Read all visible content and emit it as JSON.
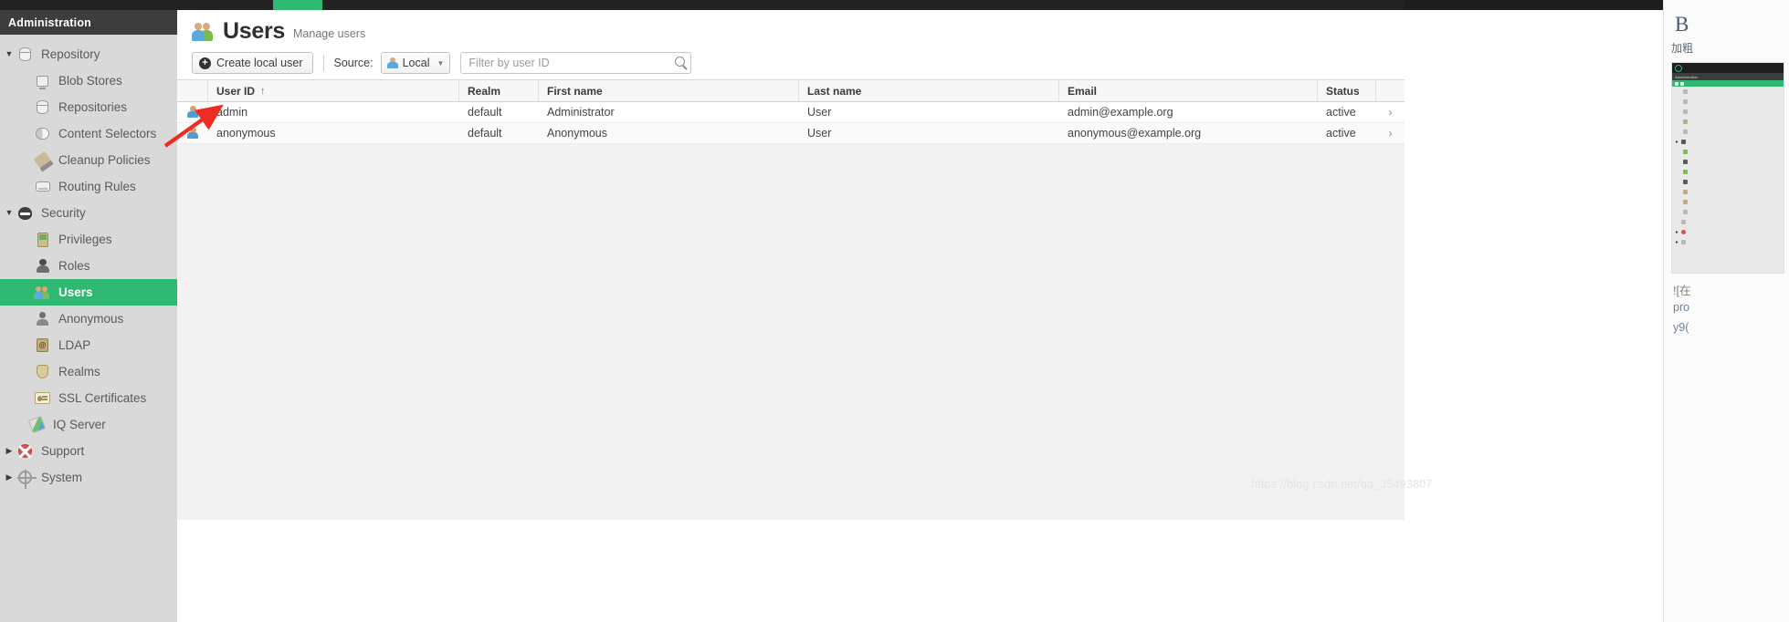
{
  "window": {
    "top_bar_tab_color": "#2eb872"
  },
  "sidebar": {
    "header": "Administration",
    "items": [
      {
        "label": "Repository",
        "icon": "database-icon",
        "level": "group",
        "caret": "down",
        "selected": false
      },
      {
        "label": "Blob Stores",
        "icon": "blob-store-icon",
        "level": "child",
        "caret": "none",
        "selected": false
      },
      {
        "label": "Repositories",
        "icon": "repositories-icon",
        "level": "child",
        "caret": "none",
        "selected": false
      },
      {
        "label": "Content Selectors",
        "icon": "content-selector-icon",
        "level": "child",
        "caret": "none",
        "selected": false
      },
      {
        "label": "Cleanup Policies",
        "icon": "cleanup-brush-icon",
        "level": "child",
        "caret": "none",
        "selected": false
      },
      {
        "label": "Routing Rules",
        "icon": "routing-rules-icon",
        "level": "child",
        "caret": "none",
        "selected": false
      },
      {
        "label": "Security",
        "icon": "security-shield-icon",
        "level": "group",
        "caret": "down",
        "selected": false
      },
      {
        "label": "Privileges",
        "icon": "privileges-icon",
        "level": "child",
        "caret": "none",
        "selected": false
      },
      {
        "label": "Roles",
        "icon": "roles-icon",
        "level": "child",
        "caret": "none",
        "selected": false
      },
      {
        "label": "Users",
        "icon": "users-icon",
        "level": "child",
        "caret": "none",
        "selected": true
      },
      {
        "label": "Anonymous",
        "icon": "anonymous-icon",
        "level": "child",
        "caret": "none",
        "selected": false
      },
      {
        "label": "LDAP",
        "icon": "ldap-icon",
        "level": "child",
        "caret": "none",
        "selected": false
      },
      {
        "label": "Realms",
        "icon": "realms-icon",
        "level": "child",
        "caret": "none",
        "selected": false
      },
      {
        "label": "SSL Certificates",
        "icon": "ssl-certificate-icon",
        "level": "child",
        "caret": "none",
        "selected": false
      },
      {
        "label": "IQ Server",
        "icon": "iq-server-icon",
        "level": "leaf",
        "caret": "none",
        "selected": false
      },
      {
        "label": "Support",
        "icon": "support-lifering-icon",
        "level": "group",
        "caret": "right",
        "selected": false
      },
      {
        "label": "System",
        "icon": "system-gear-icon",
        "level": "group",
        "caret": "right",
        "selected": false
      }
    ]
  },
  "page": {
    "title": "Users",
    "subtitle": "Manage users",
    "icon": "users-icon"
  },
  "toolbar": {
    "create_label": "Create local user",
    "create_icon": "plus-circle-icon",
    "source_label": "Source:",
    "source_value": "Local",
    "source_icon": "user-icon",
    "source_caret_icon": "chevron-down-icon",
    "filter_placeholder": "Filter by user ID",
    "filter_value": "",
    "search_icon": "search-icon"
  },
  "table": {
    "columns": [
      {
        "key": "icon",
        "label": ""
      },
      {
        "key": "user_id",
        "label": "User ID",
        "sorted": "asc",
        "sort_glyph": "↑"
      },
      {
        "key": "realm",
        "label": "Realm"
      },
      {
        "key": "first_name",
        "label": "First name"
      },
      {
        "key": "last_name",
        "label": "Last name"
      },
      {
        "key": "email",
        "label": "Email"
      },
      {
        "key": "status",
        "label": "Status"
      },
      {
        "key": "chevron",
        "label": ""
      }
    ],
    "rows": [
      {
        "icon": "user-icon",
        "user_id": "admin",
        "realm": "default",
        "first_name": "Administrator",
        "last_name": "User",
        "email": "admin@example.org",
        "status": "active",
        "chevron": "›"
      },
      {
        "icon": "user-icon",
        "user_id": "anonymous",
        "realm": "default",
        "first_name": "Anonymous",
        "last_name": "User",
        "email": "anonymous@example.org",
        "status": "active",
        "chevron": "›"
      }
    ]
  },
  "right_panel": {
    "bold_letter": "B",
    "bold_caption": "加粗",
    "thumb_header": "Administration",
    "text_lines": [
      "![在",
      "pro",
      "y9("
    ]
  },
  "annotation": {
    "arrow_color": "#ef2b24",
    "points_to": "admin"
  },
  "watermark": "https://blog.csdn.net/qq_35493807"
}
